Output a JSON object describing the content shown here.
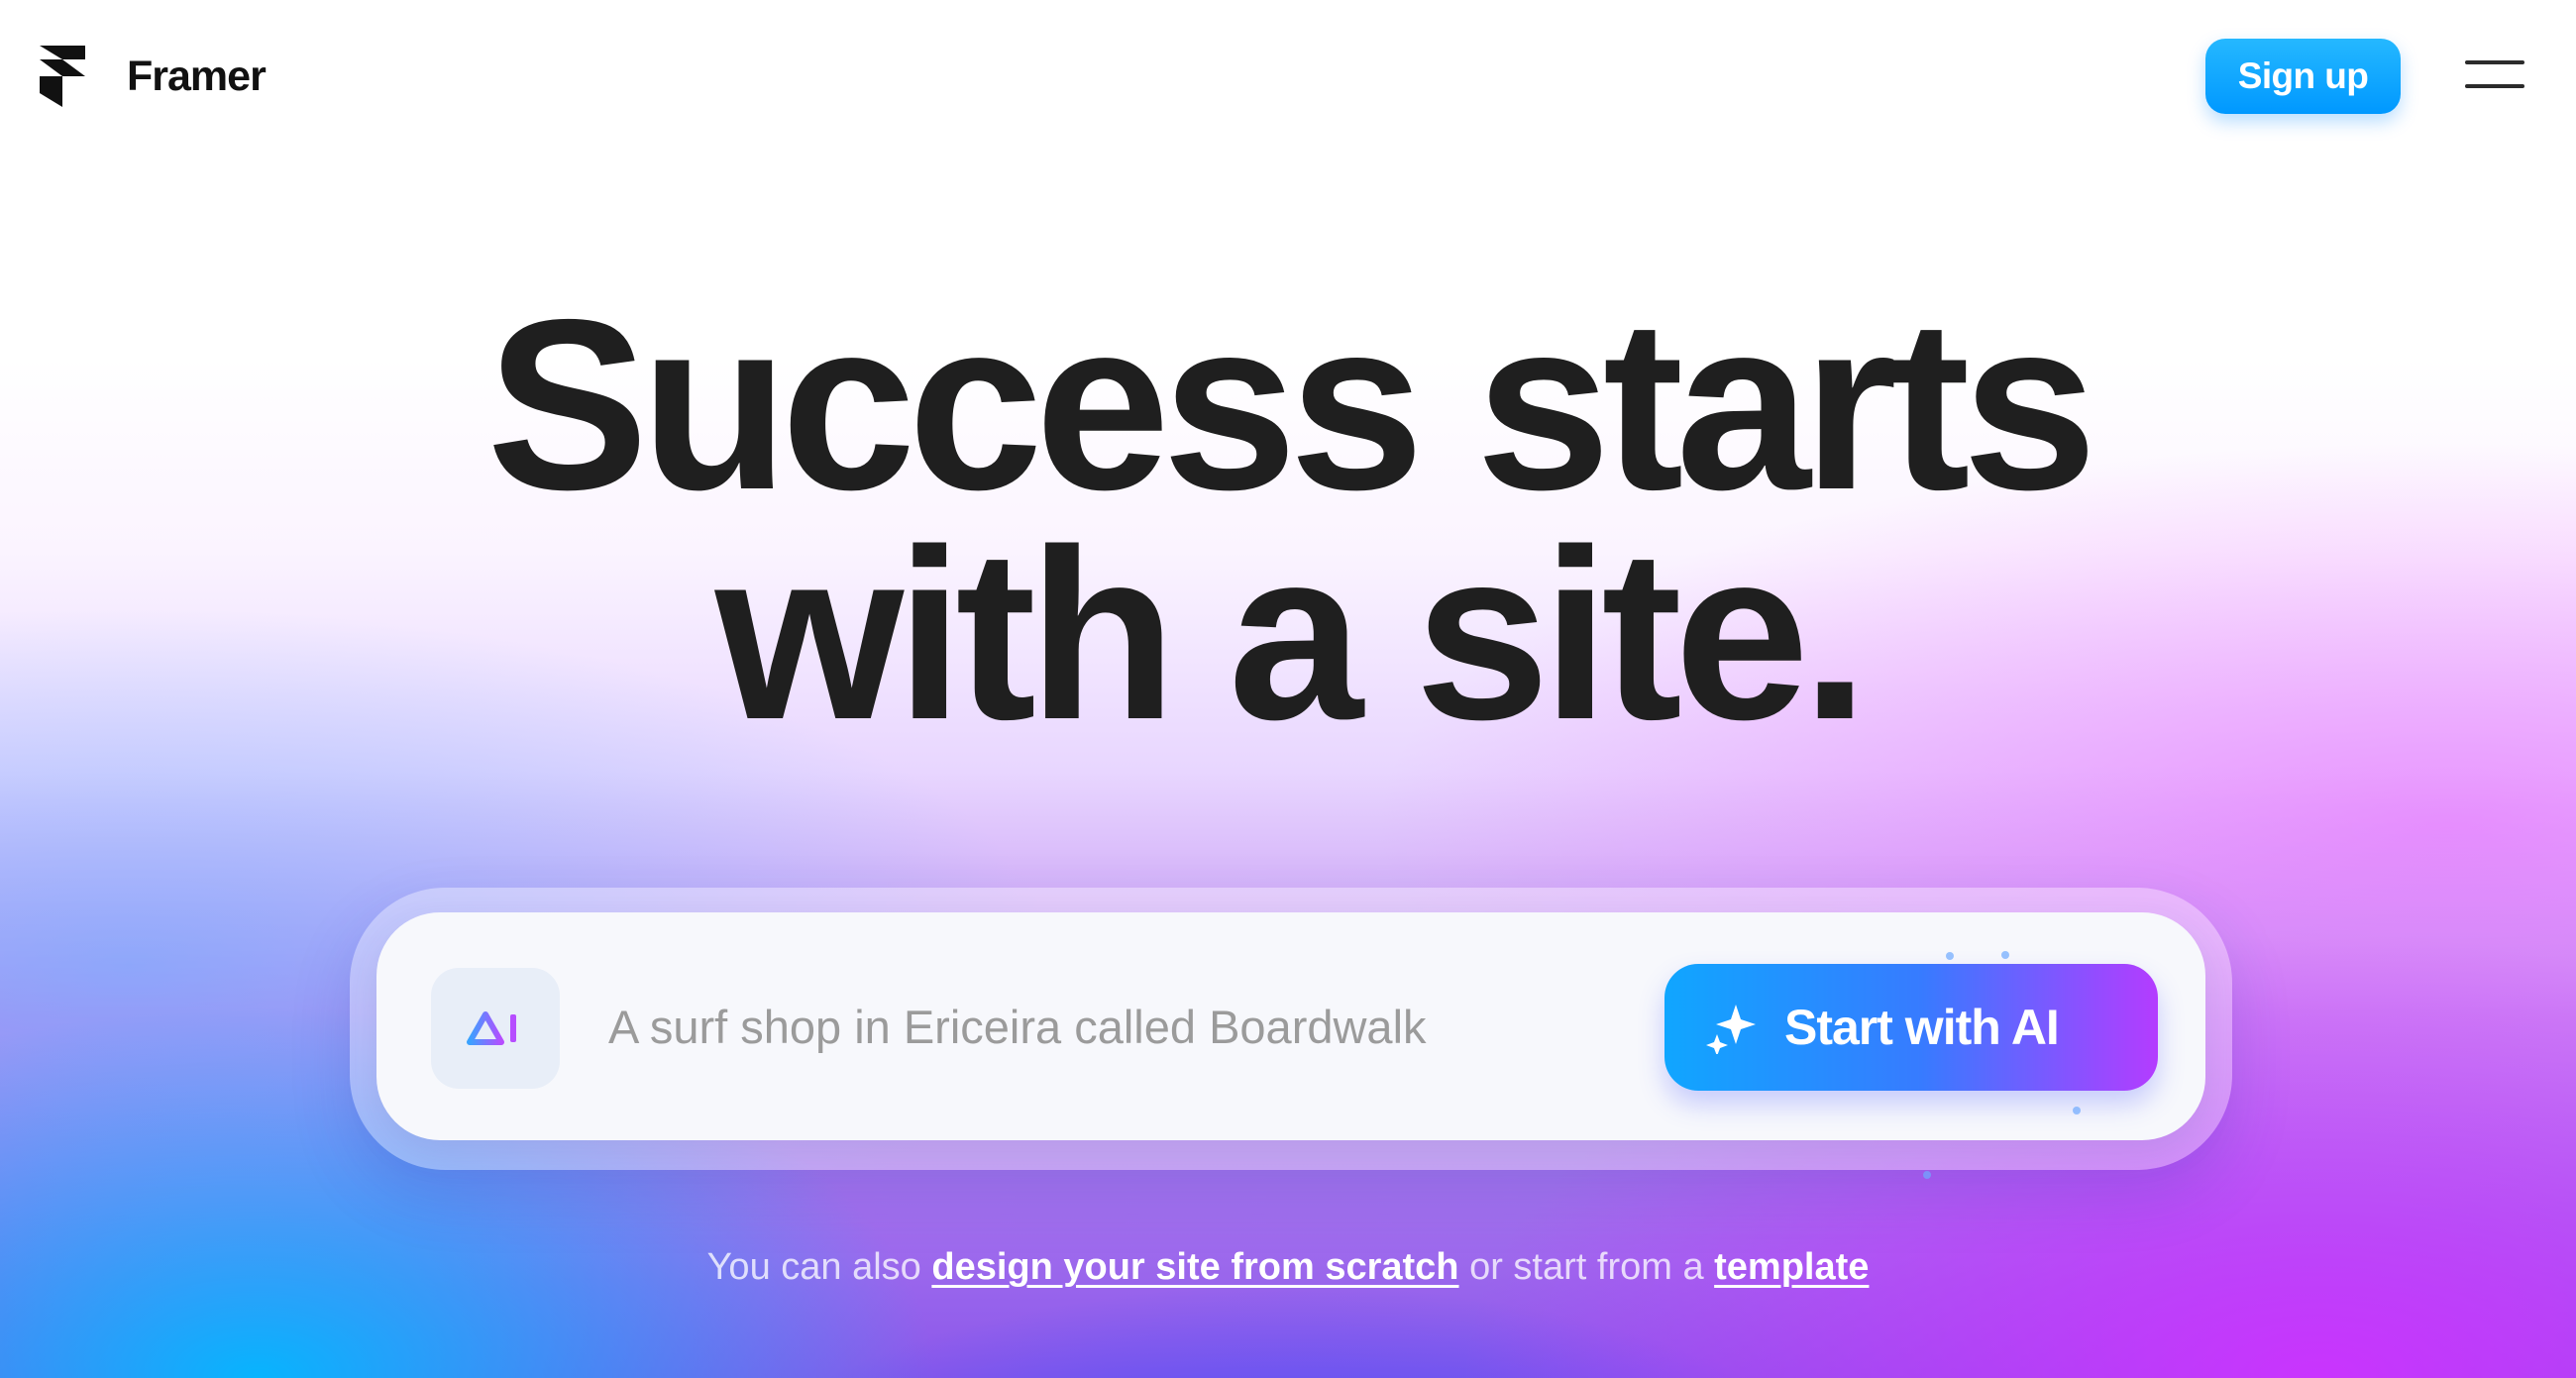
{
  "header": {
    "brand": "Framer",
    "signup_label": "Sign up"
  },
  "hero": {
    "line1": "Success starts",
    "line2": "with a site."
  },
  "prompt": {
    "placeholder": "A surf shop in Ericeira called Boardwalk",
    "value": "",
    "button_label": "Start with AI"
  },
  "footer_line": {
    "prefix": "You can also",
    "scratch_link": "design your site from scratch",
    "middle": "or start from a",
    "template_link": "template"
  },
  "icons": {
    "logo": "framer-logo",
    "menu": "hamburger-menu-icon",
    "ai": "ai-icon",
    "sparkle": "sparkle-icon"
  },
  "colors": {
    "signup": "#0098ff",
    "primary_start": "#10a6ff",
    "primary_end": "#b43cff",
    "text": "#1f1f1f"
  }
}
